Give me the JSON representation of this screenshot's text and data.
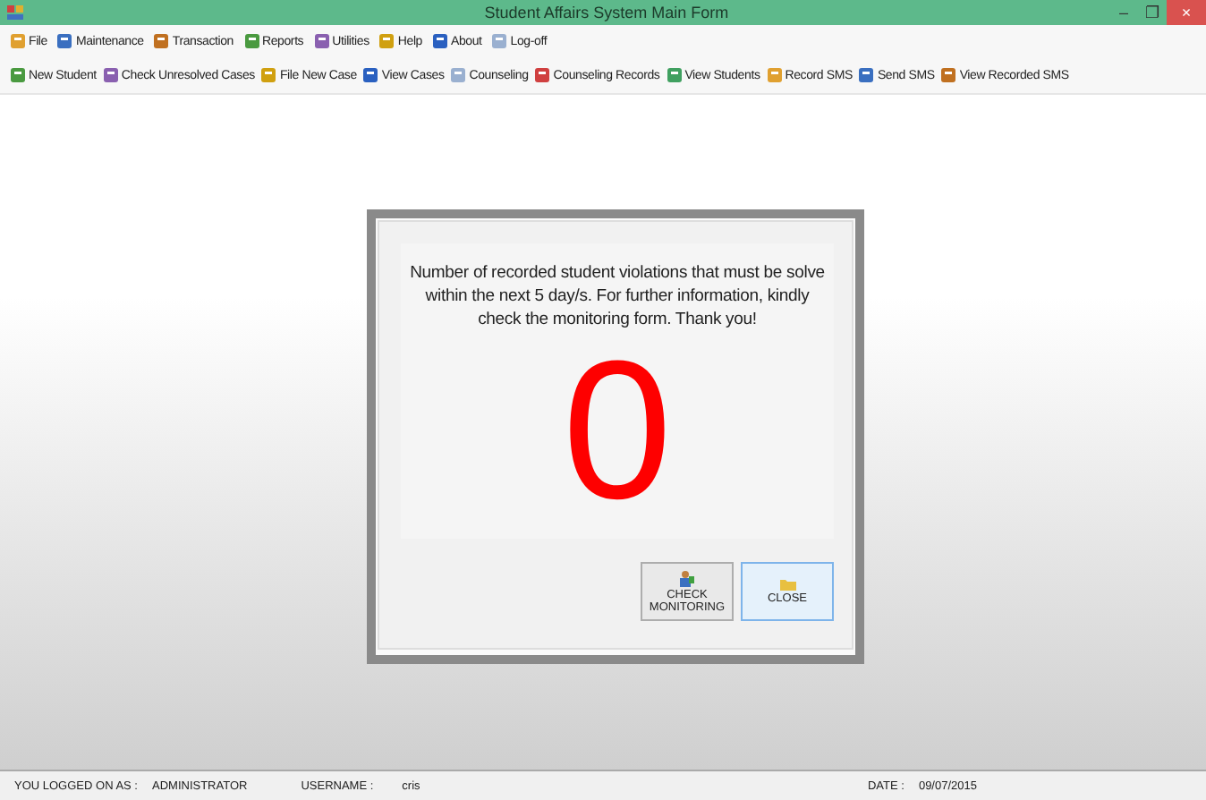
{
  "window": {
    "title": "Student Affairs System Main Form",
    "controls": [
      "–",
      "❐",
      "×"
    ]
  },
  "menu": [
    "File",
    "Maintenance",
    "Transaction",
    "Reports",
    "Utilities",
    "Help",
    "About",
    "Log-off"
  ],
  "toolbar": [
    "New Student",
    "Check Unresolved Cases",
    "File New Case",
    "View Cases",
    "Counseling",
    "Counseling Records",
    "View Students",
    "Record SMS",
    "Send SMS",
    "View Recorded SMS"
  ],
  "dialog": {
    "message": "Number of recorded student violations that must be solve within the next 5 day/s. For further information, kindly check the monitoring form. Thank you!",
    "count": "0",
    "buttons": [
      {
        "label": "CHECK MONITORING",
        "kind": "monitor",
        "selected": false
      },
      {
        "label": "CLOSE",
        "kind": "folder",
        "selected": true
      }
    ]
  },
  "status_bar": [
    {
      "label": "YOU LOGGED ON AS :",
      "value": "ADMINISTRATOR"
    },
    {
      "label": "USERNAME :",
      "value": "cris"
    },
    {
      "label": "DATE :",
      "value": "09/07/2015"
    }
  ]
}
